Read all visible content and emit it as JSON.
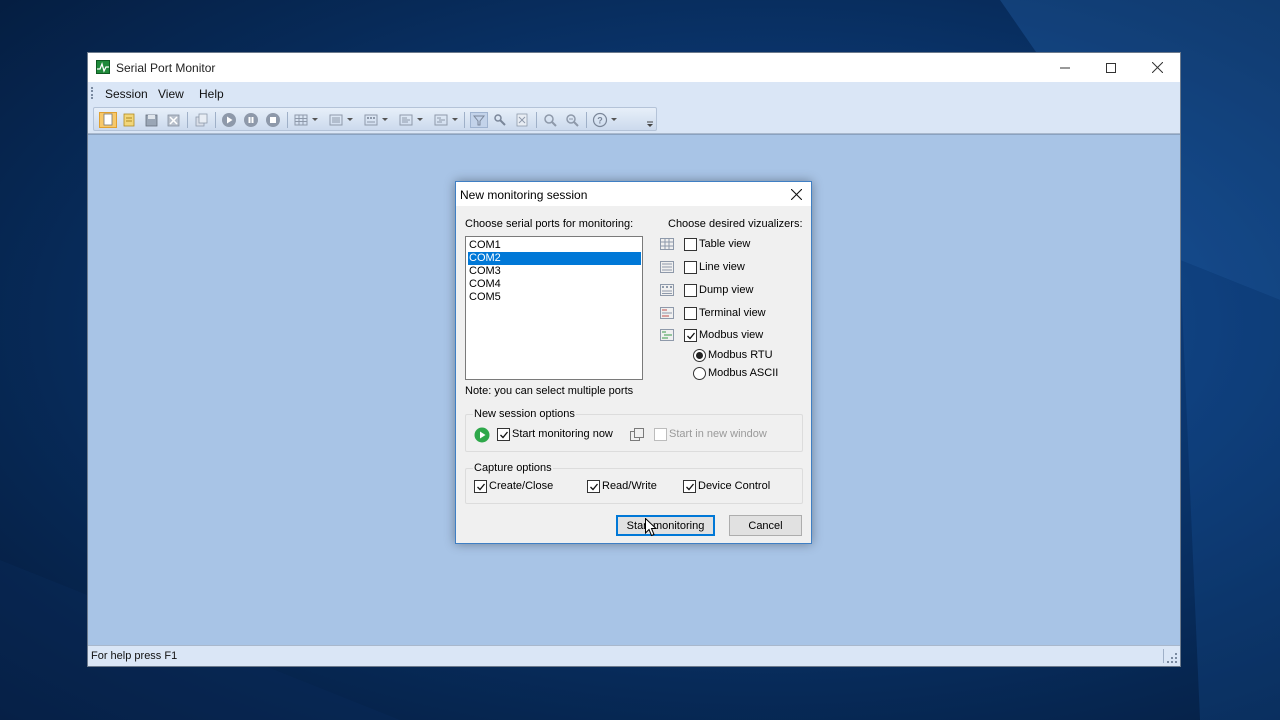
{
  "window": {
    "title": "Serial Port Monitor",
    "minimize_glyph": "—",
    "maximize_glyph": "☐",
    "close_glyph": "✕"
  },
  "menu": [
    "Session",
    "View",
    "Help"
  ],
  "toolbar": {
    "icons": [
      "new-session-icon",
      "open-icon",
      "save-icon",
      "close-session-icon",
      "copy-icon",
      "play-icon",
      "pause-icon",
      "stop-icon",
      "table-view-icon",
      "line-view-icon",
      "dump-view-icon",
      "terminal-view-icon",
      "modbus-view-icon",
      "filter-icon",
      "settings-icon",
      "export-icon",
      "find-icon",
      "find-next-icon",
      "help-icon"
    ]
  },
  "status_bar": {
    "text": "For help press F1"
  },
  "dialog": {
    "title": "New monitoring session",
    "ports_label": "Choose serial ports for monitoring:",
    "ports": [
      "COM1",
      "COM2",
      "COM3",
      "COM4",
      "COM5"
    ],
    "selected_port": "COM2",
    "ports_note": "Note: you can select multiple ports",
    "visualizers_label": "Choose desired vizualizers:",
    "visualizers": [
      {
        "label": "Table view",
        "checked": false
      },
      {
        "label": "Line view",
        "checked": false
      },
      {
        "label": "Dump view",
        "checked": false
      },
      {
        "label": "Terminal view",
        "checked": false
      },
      {
        "label": "Modbus view",
        "checked": true
      }
    ],
    "modbus_modes": [
      {
        "label": "Modbus RTU",
        "selected": true
      },
      {
        "label": "Modbus ASCII",
        "selected": false
      }
    ],
    "session_options": {
      "title": "New session options",
      "start_now": {
        "label": "Start monitoring now",
        "checked": true
      },
      "new_window": {
        "label": "Start in new window",
        "checked": false,
        "enabled": false
      }
    },
    "capture_options": {
      "title": "Capture options",
      "items": [
        {
          "label": "Create/Close",
          "checked": true
        },
        {
          "label": "Read/Write",
          "checked": true
        },
        {
          "label": "Device Control",
          "checked": true
        }
      ]
    },
    "buttons": {
      "start": "Start monitoring",
      "cancel": "Cancel"
    },
    "close_glyph": "✕"
  }
}
